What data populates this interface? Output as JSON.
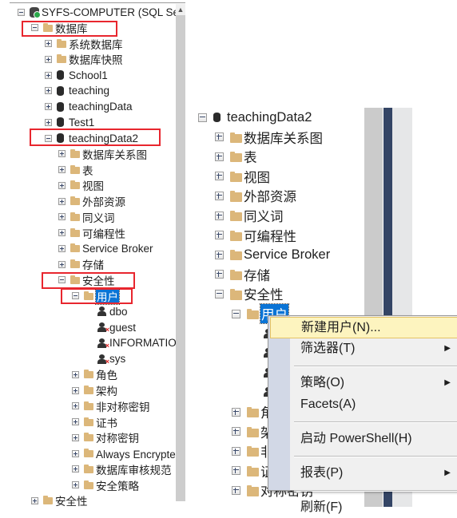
{
  "left_tree": {
    "rows": [
      {
        "level": 0,
        "exp": "minus",
        "icon": "server",
        "label": "SYFS-COMPUTER (SQL Server)"
      },
      {
        "level": 1,
        "exp": "minus",
        "icon": "folder",
        "label": "数据库"
      },
      {
        "level": 2,
        "exp": "plus",
        "icon": "folder",
        "label": "系统数据库"
      },
      {
        "level": 2,
        "exp": "plus",
        "icon": "folder",
        "label": "数据库快照"
      },
      {
        "level": 2,
        "exp": "plus",
        "icon": "database",
        "label": "School1"
      },
      {
        "level": 2,
        "exp": "plus",
        "icon": "database",
        "label": "teaching"
      },
      {
        "level": 2,
        "exp": "plus",
        "icon": "database",
        "label": "teachingData"
      },
      {
        "level": 2,
        "exp": "plus",
        "icon": "database",
        "label": "Test1"
      },
      {
        "level": 2,
        "exp": "minus",
        "icon": "database",
        "label": "teachingData2"
      },
      {
        "level": 3,
        "exp": "plus",
        "icon": "folder",
        "label": "数据库关系图"
      },
      {
        "level": 3,
        "exp": "plus",
        "icon": "folder",
        "label": "表"
      },
      {
        "level": 3,
        "exp": "plus",
        "icon": "folder",
        "label": "视图"
      },
      {
        "level": 3,
        "exp": "plus",
        "icon": "folder",
        "label": "外部资源"
      },
      {
        "level": 3,
        "exp": "plus",
        "icon": "folder",
        "label": "同义词"
      },
      {
        "level": 3,
        "exp": "plus",
        "icon": "folder",
        "label": "可编程性"
      },
      {
        "level": 3,
        "exp": "plus",
        "icon": "folder",
        "label": "Service Broker"
      },
      {
        "level": 3,
        "exp": "plus",
        "icon": "folder",
        "label": "存储"
      },
      {
        "level": 3,
        "exp": "minus",
        "icon": "folder",
        "label": "安全性"
      },
      {
        "level": 4,
        "exp": "minus",
        "icon": "folder",
        "label": "用户",
        "selected": true
      },
      {
        "level": 5,
        "exp": "none",
        "icon": "user",
        "label": "dbo"
      },
      {
        "level": 5,
        "exp": "none",
        "icon": "user-disabled",
        "label": "guest"
      },
      {
        "level": 5,
        "exp": "none",
        "icon": "user-disabled",
        "label": "INFORMATION_SCHEMA"
      },
      {
        "level": 5,
        "exp": "none",
        "icon": "user-disabled",
        "label": "sys"
      },
      {
        "level": 4,
        "exp": "plus",
        "icon": "folder",
        "label": "角色"
      },
      {
        "level": 4,
        "exp": "plus",
        "icon": "folder",
        "label": "架构"
      },
      {
        "level": 4,
        "exp": "plus",
        "icon": "folder",
        "label": "非对称密钥"
      },
      {
        "level": 4,
        "exp": "plus",
        "icon": "folder",
        "label": "证书"
      },
      {
        "level": 4,
        "exp": "plus",
        "icon": "folder",
        "label": "对称密钥"
      },
      {
        "level": 4,
        "exp": "plus",
        "icon": "folder",
        "label": "Always Encrypted 密钥"
      },
      {
        "level": 4,
        "exp": "plus",
        "icon": "folder",
        "label": "数据库审核规范"
      },
      {
        "level": 4,
        "exp": "plus",
        "icon": "folder",
        "label": "安全策略"
      },
      {
        "level": 1,
        "exp": "plus",
        "icon": "folder",
        "label": "安全性"
      }
    ]
  },
  "right_tree": {
    "rows": [
      {
        "level": 0,
        "exp": "minus",
        "icon": "database",
        "label": "teachingData2"
      },
      {
        "level": 1,
        "exp": "plus",
        "icon": "folder",
        "label": "数据库关系图"
      },
      {
        "level": 1,
        "exp": "plus",
        "icon": "folder",
        "label": "表"
      },
      {
        "level": 1,
        "exp": "plus",
        "icon": "folder",
        "label": "视图"
      },
      {
        "level": 1,
        "exp": "plus",
        "icon": "folder",
        "label": "外部资源"
      },
      {
        "level": 1,
        "exp": "plus",
        "icon": "folder",
        "label": "同义词"
      },
      {
        "level": 1,
        "exp": "plus",
        "icon": "folder",
        "label": "可编程性"
      },
      {
        "level": 1,
        "exp": "plus",
        "icon": "folder",
        "label": "Service Broker"
      },
      {
        "level": 1,
        "exp": "plus",
        "icon": "folder",
        "label": "存储"
      },
      {
        "level": 1,
        "exp": "minus",
        "icon": "folder",
        "label": "安全性"
      },
      {
        "level": 2,
        "exp": "minus",
        "icon": "folder",
        "label": "用户",
        "selected": true
      },
      {
        "level": 3,
        "exp": "none",
        "icon": "user",
        "label": ""
      },
      {
        "level": 3,
        "exp": "none",
        "icon": "user",
        "label": ""
      },
      {
        "level": 3,
        "exp": "none",
        "icon": "user",
        "label": ""
      },
      {
        "level": 3,
        "exp": "none",
        "icon": "user",
        "label": ""
      },
      {
        "level": 2,
        "exp": "plus",
        "icon": "folder",
        "label": "角色"
      },
      {
        "level": 2,
        "exp": "plus",
        "icon": "folder",
        "label": "架构"
      },
      {
        "level": 2,
        "exp": "plus",
        "icon": "folder",
        "label": "非对称密钥"
      },
      {
        "level": 2,
        "exp": "plus",
        "icon": "folder",
        "label": "证书"
      },
      {
        "level": 2,
        "exp": "plus",
        "icon": "folder",
        "label": "对称密钥"
      }
    ]
  },
  "context_menu": {
    "items": [
      {
        "label": "新建用户(N)...",
        "submenu": false,
        "highlighted": true
      },
      {
        "label": "筛选器(T)",
        "submenu": true
      },
      {
        "separator": true
      },
      {
        "label": "策略(O)",
        "submenu": true
      },
      {
        "label": "Facets(A)",
        "submenu": false
      },
      {
        "separator": true
      },
      {
        "label": "启动 PowerShell(H)",
        "submenu": false
      },
      {
        "separator": true
      },
      {
        "label": "报表(P)",
        "submenu": true
      },
      {
        "separator": true
      },
      {
        "label": "刷新(F)",
        "submenu": false
      }
    ]
  },
  "colors": {
    "highlight_box": "#e8262e",
    "selection": "#0a74d6",
    "menu_hover": "#fdf4bf",
    "folder": "#dcb77a"
  }
}
